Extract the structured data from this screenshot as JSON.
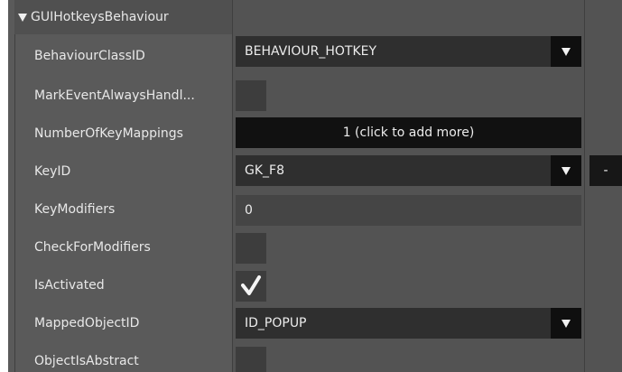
{
  "section": {
    "title": "GUIHotkeysBehaviour"
  },
  "rows": {
    "behaviour_class_id": {
      "label": "BehaviourClassID",
      "value": "BEHAVIOUR_HOTKEY"
    },
    "mark_event_always_handled": {
      "label": "MarkEventAlwaysHandl..."
    },
    "number_of_key_mappings": {
      "label": "NumberOfKeyMappings",
      "button_label": "1 (click to add more)"
    },
    "key_id": {
      "label": "KeyID",
      "value": "GK_F8",
      "remove_label": "-"
    },
    "key_modifiers": {
      "label": "KeyModifiers",
      "value": "0"
    },
    "check_for_modifiers": {
      "label": "CheckForModifiers"
    },
    "is_activated": {
      "label": "IsActivated",
      "checked": true
    },
    "mapped_object_id": {
      "label": "MappedObjectID",
      "value": "ID_POPUP"
    },
    "object_is_abstract": {
      "label": "ObjectIsAbstract"
    }
  },
  "icons": {
    "collapse": "triangle-down-icon",
    "dropdown": "chevron-down-icon",
    "check": "checkmark-icon"
  },
  "colors": {
    "label_background": "#5a5a5a",
    "value_background": "#535353",
    "dropdown_background": "#2f2f2f",
    "button_background": "#111111",
    "text": "#e8e8e8"
  }
}
